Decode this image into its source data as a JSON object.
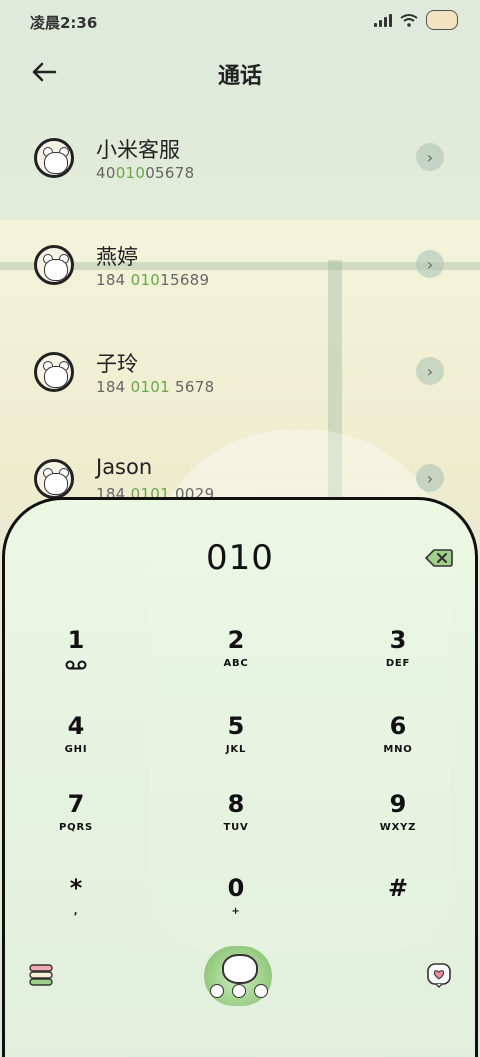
{
  "status_bar": {
    "time": "凌晨2:36"
  },
  "header": {
    "title": "通话"
  },
  "contacts": [
    {
      "name": "小米客服",
      "number_parts": [
        "40",
        "010",
        "05678"
      ]
    },
    {
      "name": "燕婷",
      "number_parts": [
        "184 ",
        "010",
        "15689"
      ]
    },
    {
      "name": "子玲",
      "number_parts": [
        "184 ",
        "0101",
        " 5678"
      ]
    },
    {
      "name": "Jason",
      "number_parts": [
        "184 ",
        "0101",
        " 0029"
      ]
    }
  ],
  "dialer": {
    "display": "010",
    "keys": [
      {
        "digit": "1",
        "letters": ""
      },
      {
        "digit": "2",
        "letters": "ABC"
      },
      {
        "digit": "3",
        "letters": "DEF"
      },
      {
        "digit": "4",
        "letters": "GHI"
      },
      {
        "digit": "5",
        "letters": "JKL"
      },
      {
        "digit": "6",
        "letters": "MNO"
      },
      {
        "digit": "7",
        "letters": "PQRS"
      },
      {
        "digit": "8",
        "letters": "TUV"
      },
      {
        "digit": "9",
        "letters": "WXYZ"
      },
      {
        "digit": "*",
        "letters": ","
      },
      {
        "digit": "0",
        "letters": "+"
      },
      {
        "digit": "#",
        "letters": ""
      }
    ]
  },
  "icons": {
    "back": "arrow-left-icon",
    "backspace": "backspace-icon",
    "voicemail": "voicemail-icon",
    "menu": "stack-menu-icon",
    "call": "call-button-icon",
    "favorite": "heart-icon"
  },
  "colors": {
    "highlight": "#6aa54a",
    "accent": "#7dbb66"
  }
}
